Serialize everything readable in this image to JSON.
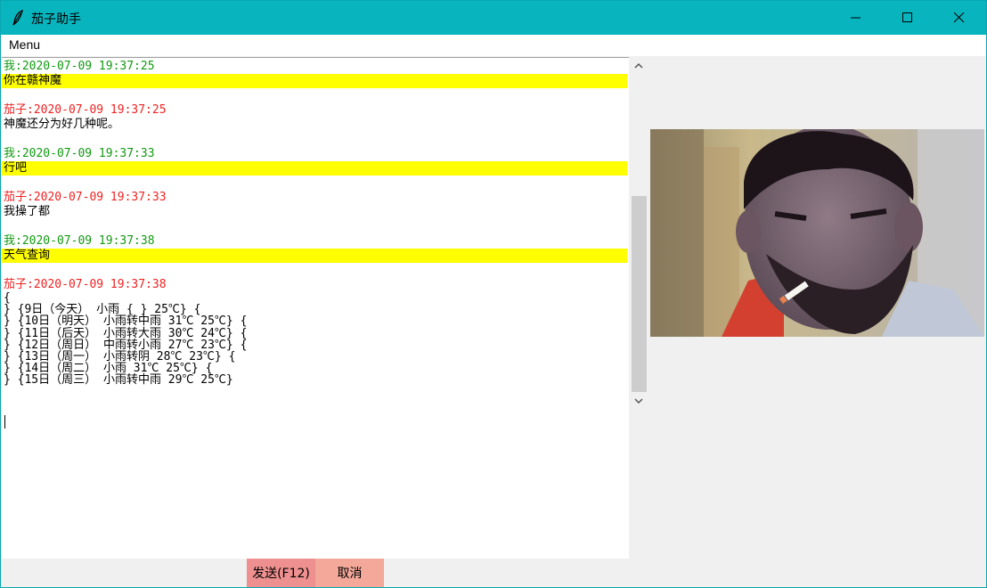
{
  "window": {
    "title": "茄子助手"
  },
  "menu": {
    "items": [
      "Menu"
    ]
  },
  "chat": {
    "messages": [
      {
        "sender": "me",
        "header": "我:2020-07-09 19:37:25",
        "lines": [
          "你在赣神魔"
        ]
      },
      {
        "sender": "bot",
        "header": "茄子:2020-07-09 19:37:25",
        "lines": [
          "神魔还分为好几种呢。"
        ]
      },
      {
        "sender": "me",
        "header": "我:2020-07-09 19:37:33",
        "lines": [
          "行吧"
        ]
      },
      {
        "sender": "bot",
        "header": "茄子:2020-07-09 19:37:33",
        "lines": [
          "我操了都"
        ]
      },
      {
        "sender": "me",
        "header": "我:2020-07-09 19:37:38",
        "lines": [
          "天气查询"
        ]
      },
      {
        "sender": "bot",
        "header": "茄子:2020-07-09 19:37:38",
        "lines": [
          "{",
          "} {9日（今天） 小雨 { } 25℃} {",
          "} {10日（明天） 小雨转中雨 31℃ 25℃} {",
          "} {11日（后天） 小雨转大雨 30℃ 24℃} {",
          "} {12日（周日） 中雨转小雨 27℃ 23℃} {",
          "} {13日（周一） 小雨转阴 28℃ 23℃} {",
          "} {14日（周二） 小雨 31℃ 25℃} {",
          "} {15日（周三） 小雨转中雨 29℃ 25℃}"
        ]
      }
    ]
  },
  "input": {
    "value": ""
  },
  "buttons": {
    "send": "发送(F12)",
    "cancel": "取消"
  },
  "colors": {
    "titlebar": "#08b5bf",
    "me_header": "#119a11",
    "bot_header": "#ee2222",
    "me_highlight": "#ffff00",
    "send_button": "#ee9090",
    "cancel_button": "#f3a89a"
  },
  "icons": [
    "app-feather-icon",
    "minimize-icon",
    "maximize-icon",
    "close-icon",
    "scroll-up-icon",
    "scroll-down-icon"
  ]
}
